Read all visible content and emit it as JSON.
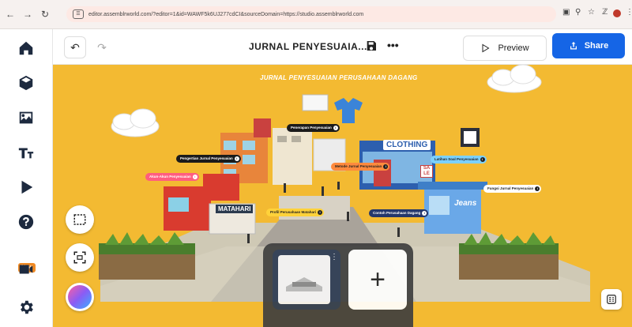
{
  "browser": {
    "url": "editor.assemblrworld.com/?editor=1&id=WAWF5k6UJ277cdCI&sourceDomain=https://studio.assemblrworld.com"
  },
  "rail": {
    "new_badge": "New"
  },
  "toolbar": {
    "title": "JURNAL PENYESUAIA...",
    "more": "•••",
    "preview_label": "Preview",
    "share_label": "Share"
  },
  "scene": {
    "title": "JURNAL PENYESUAIAN PERUSAHAAN DAGANG",
    "tags": {
      "penerapan": "Penerapan Penyesuaian",
      "pengertian": "Pengertian Jurnal Penyesuaian",
      "akun": "Akun-Akun Penyesuaian",
      "metode": "Metode Jurnal Penyesuaian",
      "latihan": "Latihan Soal Penyesuaian",
      "fungsi": "Fungsi Jurnal Penyesuaian",
      "contoh": "Contoh Perusahaan Dagang",
      "profil": "Profil Perusahaan Matahari"
    },
    "signs": {
      "clothing": "CLOTHING",
      "matahari": "MATAHARI",
      "jeans": "Jeans",
      "sale": "SA LE"
    }
  },
  "tray": {
    "add_symbol": "+"
  },
  "colors": {
    "canvas_bg": "#f3ba32",
    "share_blue": "#1565e6",
    "rail_icon": "#1d2a3f"
  }
}
